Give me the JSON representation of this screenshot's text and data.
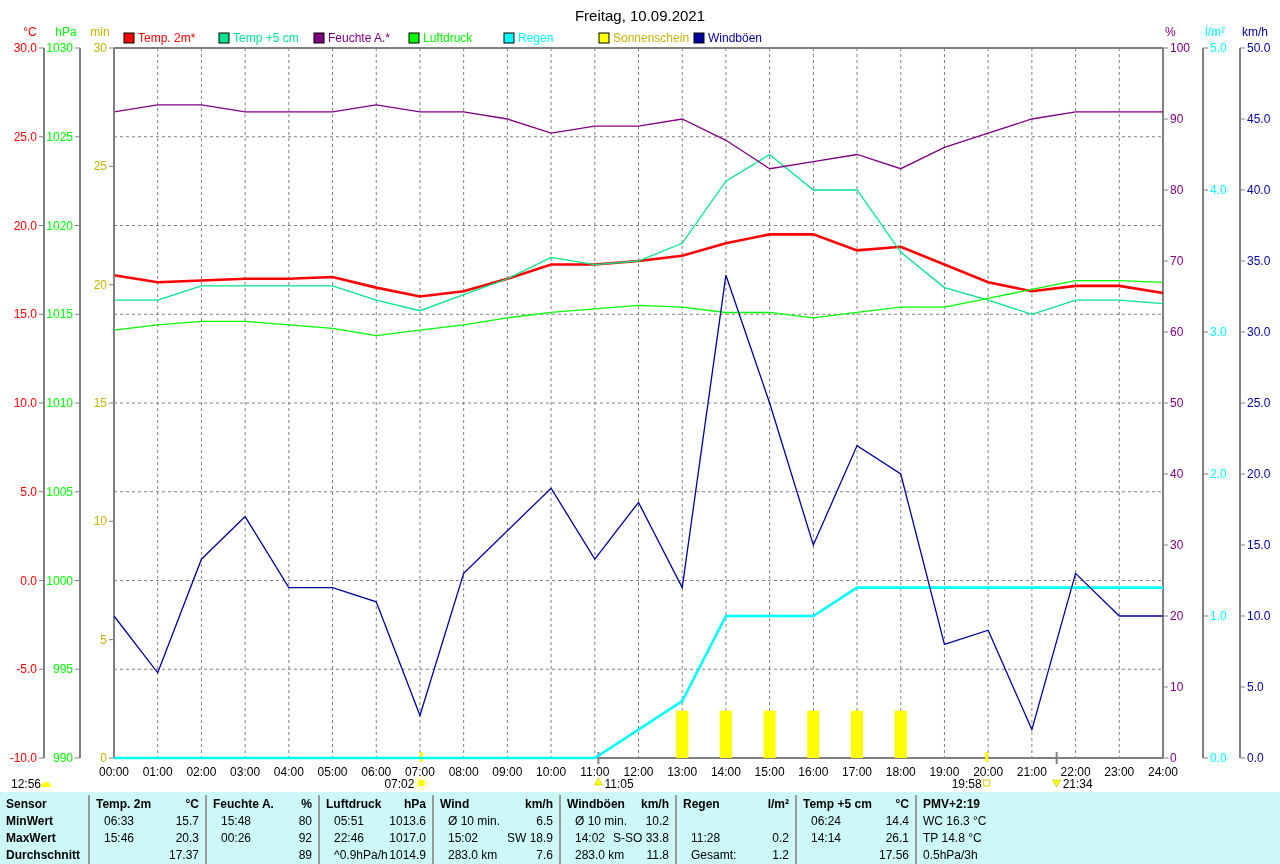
{
  "title": "Freitag, 10.09.2021",
  "climate_chart": {
    "chart_data": {
      "type": "line",
      "grid": true,
      "legend": "top",
      "x": [
        0,
        1,
        2,
        3,
        4,
        5,
        6,
        7,
        8,
        9,
        10,
        11,
        12,
        13,
        14,
        15,
        16,
        17,
        18,
        19,
        20,
        21,
        22,
        23,
        24
      ],
      "xlim": [
        0,
        24
      ],
      "xticks": [
        {
          "value": 0,
          "label": "00:00"
        },
        {
          "value": 1,
          "label": "01:00"
        },
        {
          "value": 2,
          "label": "02:00"
        },
        {
          "value": 3,
          "label": "03:00"
        },
        {
          "value": 4,
          "label": "04:00"
        },
        {
          "value": 5,
          "label": "05:00"
        },
        {
          "value": 6,
          "label": "06:00"
        },
        {
          "value": 7,
          "label": "07:00"
        },
        {
          "value": 8,
          "label": "08:00"
        },
        {
          "value": 9,
          "label": "09:00"
        },
        {
          "value": 10,
          "label": "10:00"
        },
        {
          "value": 11,
          "label": "11:00"
        },
        {
          "value": 12,
          "label": "12:00"
        },
        {
          "value": 13,
          "label": "13:00"
        },
        {
          "value": 14,
          "label": "14:00"
        },
        {
          "value": 15,
          "label": "15:00"
        },
        {
          "value": 16,
          "label": "16:00"
        },
        {
          "value": 17,
          "label": "17:00"
        },
        {
          "value": 18,
          "label": "18:00"
        },
        {
          "value": 19,
          "label": "19:00"
        },
        {
          "value": 20,
          "label": "20:00"
        },
        {
          "value": 21,
          "label": "21:00"
        },
        {
          "value": 22,
          "label": "22:00"
        },
        {
          "value": 23,
          "label": "23:00"
        },
        {
          "value": 24,
          "label": "24:00"
        }
      ],
      "ylabel": "°C",
      "ylim": [
        -10,
        30
      ],
      "yticks": [
        {
          "value": -10,
          "label": "-10.0"
        },
        {
          "value": -5,
          "label": "-5.0"
        },
        {
          "value": 0,
          "label": "0.0"
        },
        {
          "value": 5,
          "label": "5.0"
        },
        {
          "value": 10,
          "label": "10.0"
        },
        {
          "value": 15,
          "label": "15.0"
        },
        {
          "value": 20,
          "label": "20.0"
        },
        {
          "value": 25,
          "label": "25.0"
        },
        {
          "value": 30,
          "label": "30.0"
        }
      ],
      "y2label": "hPa",
      "y2lim": [
        990,
        1030
      ],
      "y2ticks": [
        990,
        995,
        1000,
        1005,
        1010,
        1015,
        1020,
        1025,
        1030
      ],
      "y3label": "%",
      "y3lim": [
        0,
        100
      ],
      "y3ticks": [
        0,
        10,
        20,
        30,
        40,
        50,
        60,
        70,
        80,
        90,
        100
      ],
      "series": [
        {
          "name": "Temp. 2m*",
          "color": "#ff0000",
          "values": [
            17.2,
            16.8,
            16.9,
            17.0,
            17.0,
            17.1,
            16.5,
            16.0,
            16.3,
            17.0,
            17.8,
            17.8,
            18.0,
            18.3,
            19.0,
            19.5,
            19.5,
            18.6,
            18.8,
            17.8,
            16.8,
            16.3,
            16.6,
            16.6,
            16.2
          ]
        },
        {
          "name": "Temp +5 cm",
          "color": "#00e68a",
          "values": [
            15.8,
            15.8,
            16.6,
            16.6,
            16.6,
            16.6,
            15.8,
            15.2,
            16.1,
            17.0,
            18.2,
            17.8,
            18.0,
            19.0,
            22.5,
            24.0,
            22.0,
            22.0,
            18.5,
            16.5,
            15.8,
            15.0,
            15.8,
            15.8,
            15.6
          ]
        },
        {
          "name": "Feuchte A.*",
          "color": "#800080",
          "axis": "y3",
          "values": [
            91,
            92,
            92,
            91,
            91,
            91,
            92,
            91,
            91,
            90,
            88,
            89,
            89,
            90,
            87,
            83,
            84,
            85,
            83,
            86,
            88,
            90,
            91,
            91,
            91
          ]
        },
        {
          "name": "Luftdruck",
          "color": "#00ff00",
          "axis": "y2",
          "values": [
            1014.1,
            1014.4,
            1014.6,
            1014.6,
            1014.4,
            1014.2,
            1013.8,
            1014.1,
            1014.4,
            1014.8,
            1015.1,
            1015.3,
            1015.5,
            1015.4,
            1015.1,
            1015.1,
            1014.8,
            1015.1,
            1015.4,
            1015.4,
            1015.9,
            1016.4,
            1016.9,
            1016.9,
            1016.8
          ]
        }
      ]
    }
  },
  "weather_chart": {
    "chart_data": {
      "type": "line",
      "x": [
        0,
        1,
        2,
        3,
        4,
        5,
        6,
        7,
        8,
        9,
        10,
        11,
        12,
        13,
        14,
        15,
        16,
        17,
        18,
        19,
        20,
        21,
        22,
        23,
        24
      ],
      "xlim": [
        0,
        24
      ],
      "ylabel": "min",
      "ylim": [
        0,
        30
      ],
      "yticks": [
        0,
        5,
        10,
        15,
        20,
        25,
        30
      ],
      "y2label": "l/m²",
      "y2lim": [
        0,
        5
      ],
      "y2ticks": [
        {
          "value": 0,
          "label": "0.0"
        },
        {
          "value": 1,
          "label": "1.0"
        },
        {
          "value": 2,
          "label": "2.0"
        },
        {
          "value": 3,
          "label": "3.0"
        },
        {
          "value": 4,
          "label": "4.0"
        },
        {
          "value": 5,
          "label": "5.0"
        }
      ],
      "y3label": "km/h",
      "y3lim": [
        0,
        50
      ],
      "y3ticks": [
        {
          "value": 0,
          "label": "0.0"
        },
        {
          "value": 5,
          "label": "5.0"
        },
        {
          "value": 10,
          "label": "10.0"
        },
        {
          "value": 15,
          "label": "15.0"
        },
        {
          "value": 20,
          "label": "20.0"
        },
        {
          "value": 25,
          "label": "25.0"
        },
        {
          "value": 30,
          "label": "30.0"
        },
        {
          "value": 35,
          "label": "35.0"
        },
        {
          "value": 40,
          "label": "40.0"
        },
        {
          "value": 45,
          "label": "45.0"
        },
        {
          "value": 50,
          "label": "50.0"
        }
      ],
      "series": [
        {
          "name": "Regen",
          "color": "#00ffff",
          "axis": "y2",
          "values": [
            0,
            0,
            0,
            0,
            0,
            0,
            0,
            0,
            0,
            0,
            0,
            0,
            0.2,
            0.4,
            1.0,
            1.0,
            1.0,
            1.2,
            1.2,
            1.2,
            1.2,
            1.2,
            1.2,
            1.2,
            1.2
          ]
        },
        {
          "name": "Sonnenschein",
          "color": "#ffff00",
          "type": "bar",
          "values": [
            0,
            0,
            0,
            0,
            0,
            0,
            0,
            0,
            0,
            0,
            0,
            0,
            0,
            2,
            2,
            2,
            2,
            2,
            2,
            0,
            0,
            0,
            0,
            0,
            0
          ]
        },
        {
          "name": "Windböen",
          "color": "#0000a0",
          "axis": "y3",
          "values": [
            10,
            6,
            14,
            17,
            12,
            12,
            11,
            3,
            13,
            16,
            19,
            14,
            18,
            12,
            34,
            25,
            15,
            22,
            20,
            8,
            9,
            2,
            13,
            10,
            10
          ]
        }
      ]
    }
  },
  "astro_events": [
    {
      "time": "12:56",
      "kind": "moon"
    },
    {
      "time": "07:02",
      "kind": "sunrise"
    },
    {
      "time": "11:05",
      "kind": "moonrise"
    },
    {
      "time": "19:58",
      "kind": "sunset"
    },
    {
      "time": "21:34",
      "kind": "moonset"
    }
  ],
  "stats": {
    "row_labels": [
      "Sensor",
      "MinWert",
      "MaxWert",
      "Durchschnitt"
    ],
    "columns": [
      {
        "kind": "stat",
        "name": "Temp. 2m",
        "unit": "°C",
        "rows": [
          {
            "time": "06:33",
            "value": "15.7"
          },
          {
            "time": "15:46",
            "value": "20.3"
          },
          {
            "value": "17.37"
          }
        ]
      },
      {
        "kind": "stat",
        "name": "Feuchte A.",
        "unit": "%",
        "rows": [
          {
            "time": "15:48",
            "value": "80"
          },
          {
            "time": "00:26",
            "value": "92"
          },
          {
            "value": "89"
          }
        ]
      },
      {
        "kind": "stat",
        "name": "Luftdruck",
        "unit": "hPa",
        "rows": [
          {
            "time": "05:51",
            "value": "1013.6"
          },
          {
            "time": "22:46",
            "value": "1017.0"
          },
          {
            "time": "^0.9hPa/h",
            "value": "1014.9"
          }
        ]
      },
      {
        "kind": "stat",
        "name": "Wind",
        "unit": "km/h",
        "rows": [
          {
            "time": "Ø 10 min.",
            "value": "6.5"
          },
          {
            "time": "15:02",
            "value": "SW 18.9"
          },
          {
            "time": "283.0 km",
            "value": "7.6"
          }
        ]
      },
      {
        "kind": "stat",
        "name": "Windböen",
        "unit": "km/h",
        "rows": [
          {
            "time": "Ø 10 min.",
            "value": "10.2"
          },
          {
            "time": "14:02",
            "value": "S-SO 33.8"
          },
          {
            "time": "283.0 km",
            "value": "11.8"
          }
        ]
      },
      {
        "kind": "stat",
        "name": "Regen",
        "unit": "l/m²",
        "rows": [
          {},
          {
            "time": "11:28",
            "value": "0.2"
          },
          {
            "time": "Gesamt:",
            "value": "1.2"
          }
        ]
      },
      {
        "kind": "stat",
        "name": "Temp +5 cm",
        "unit": "°C",
        "rows": [
          {
            "time": "06:24",
            "value": "14.4"
          },
          {
            "time": "14:14",
            "value": "26.1"
          },
          {
            "value": "17.56"
          }
        ]
      },
      {
        "kind": "notes",
        "name": "PMV+2:19",
        "lines": [
          "WC 16.3 °C",
          "TP 14.8 °C",
          "0.5hPa/3h"
        ]
      }
    ]
  }
}
